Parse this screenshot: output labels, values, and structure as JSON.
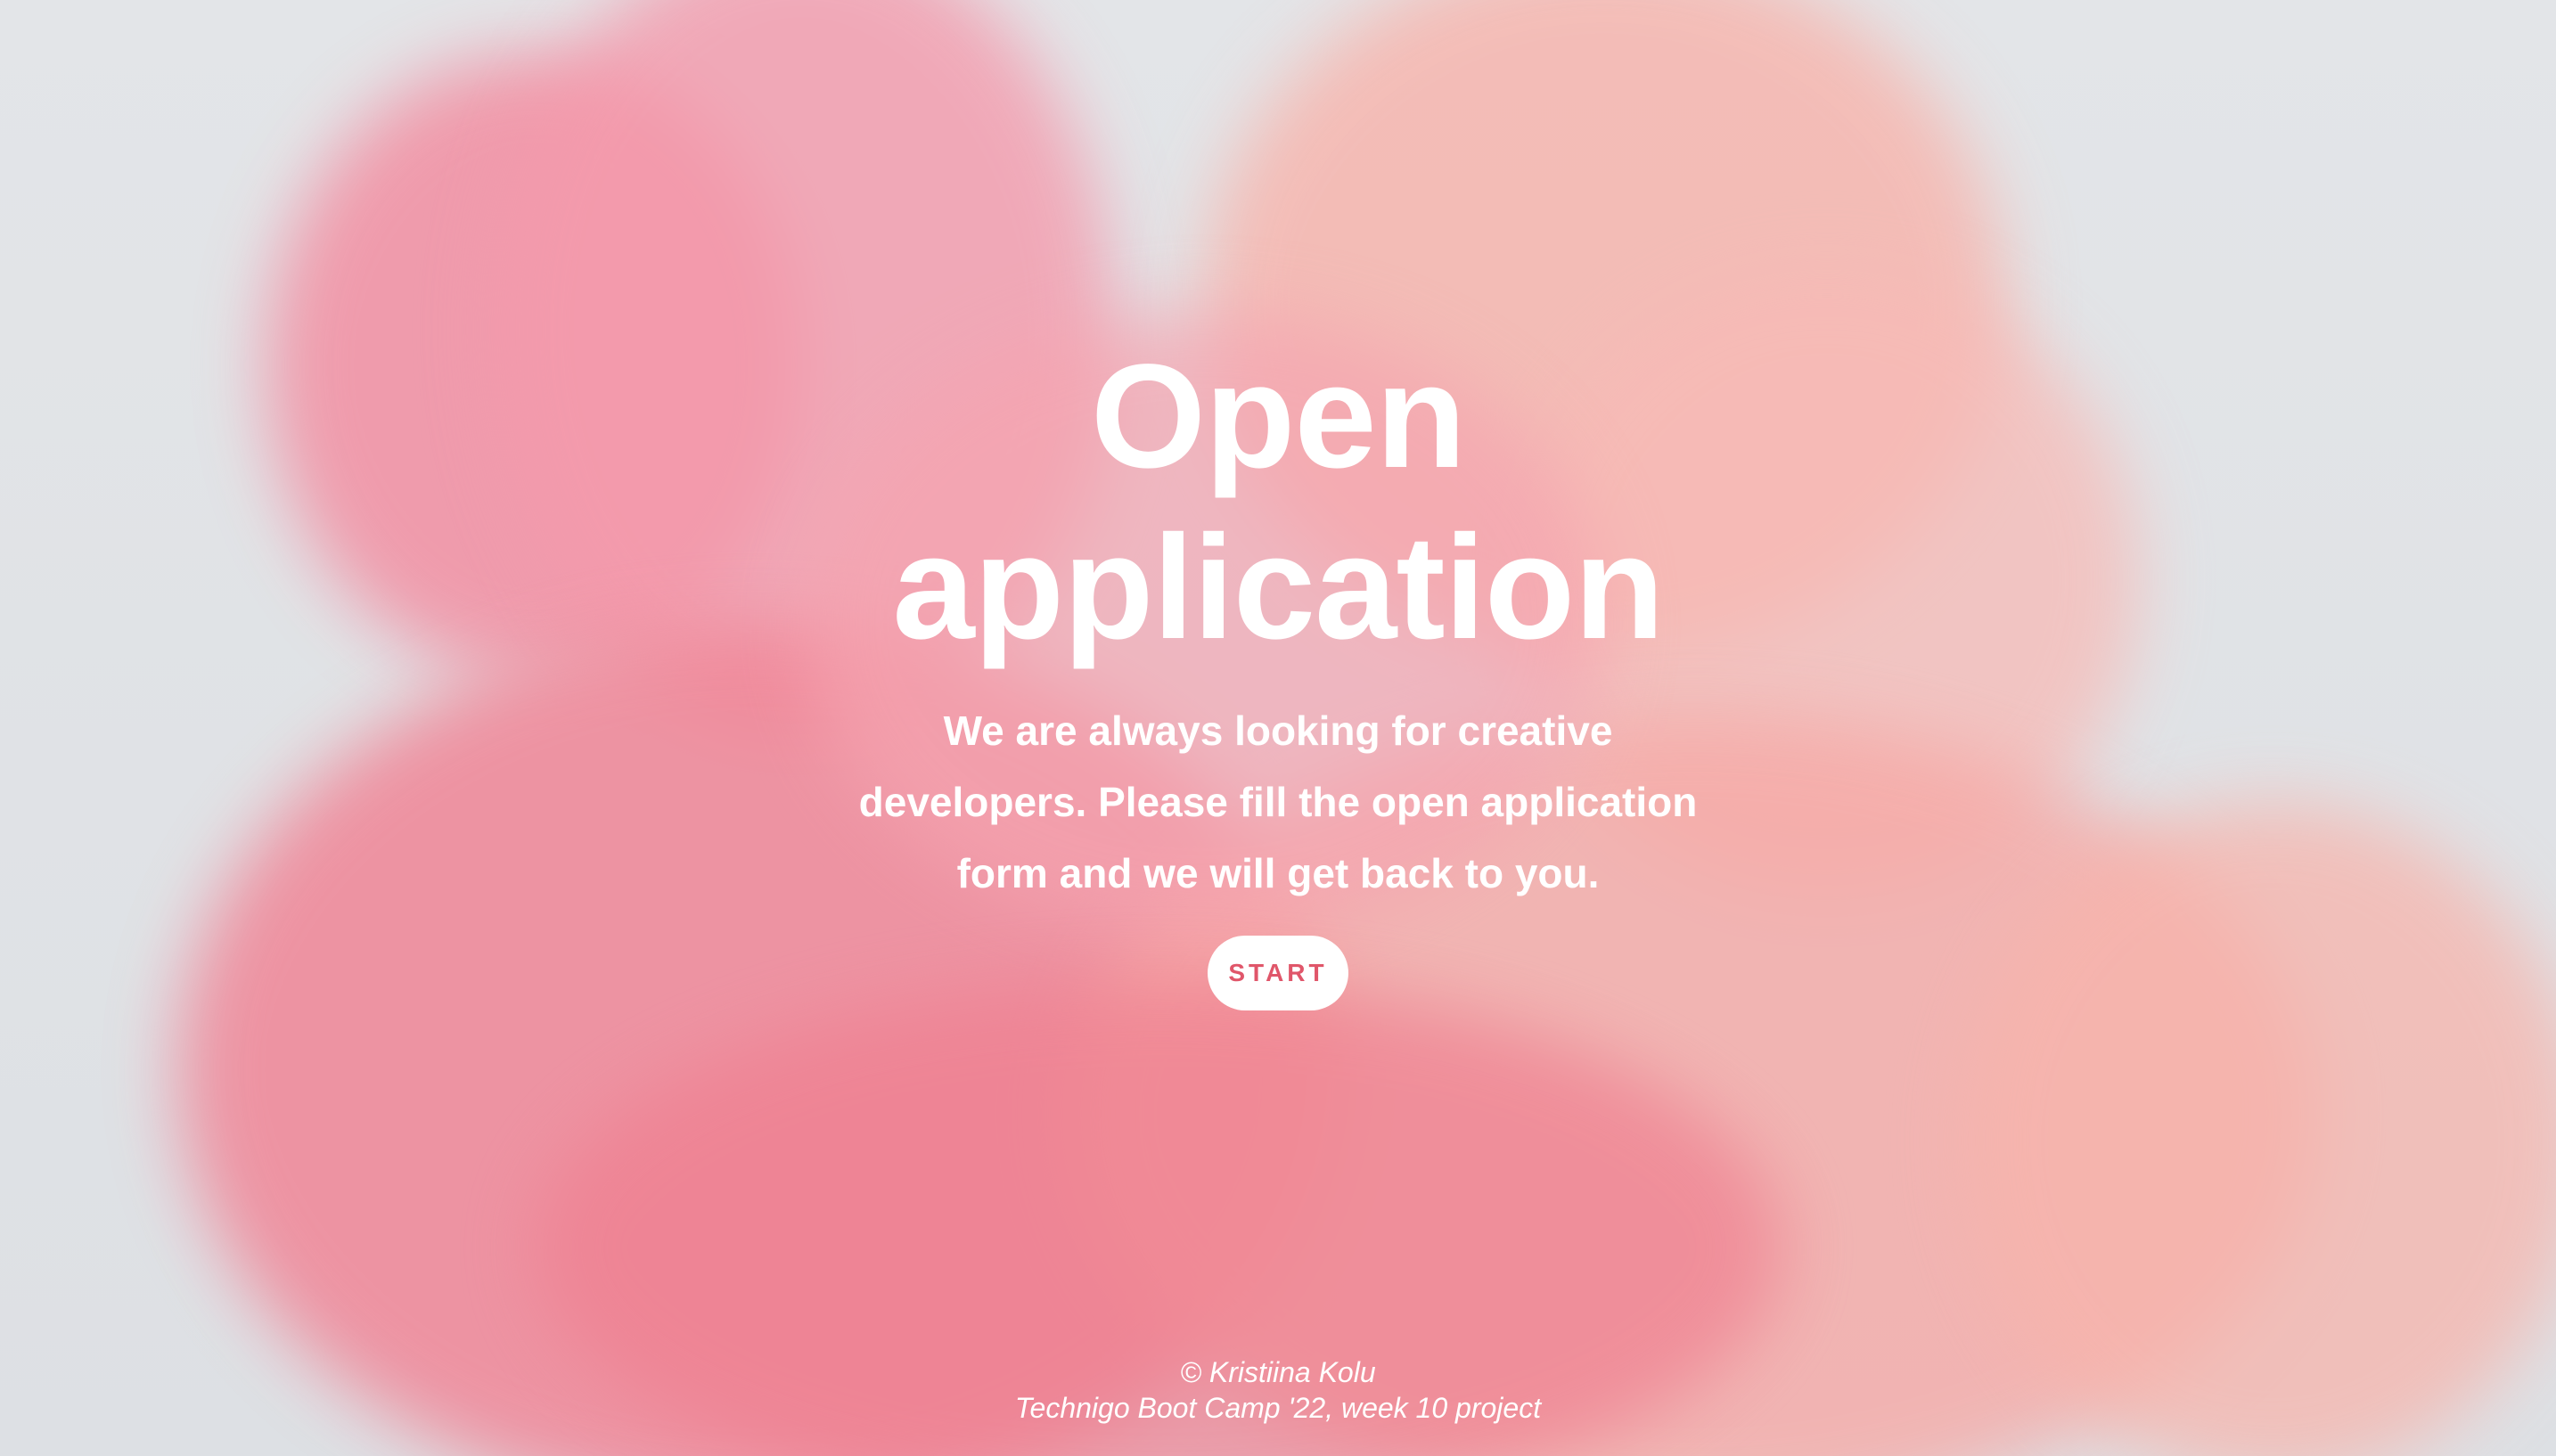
{
  "hero": {
    "title_line1": "Open",
    "title_line2": "application",
    "subtitle": "We are always looking for creative developers. Please fill the open application form and we will get back to you.",
    "start_label": "START"
  },
  "footer": {
    "copyright": "© Kristiina Kolu",
    "project": "Technigo Boot Camp '22, week 10 project"
  },
  "colors": {
    "background": "#dfe2e6",
    "smoke_pink": "#f08fa0",
    "smoke_peach": "#f7b4ab",
    "text": "#ffffff",
    "button_text": "#e0566a"
  }
}
